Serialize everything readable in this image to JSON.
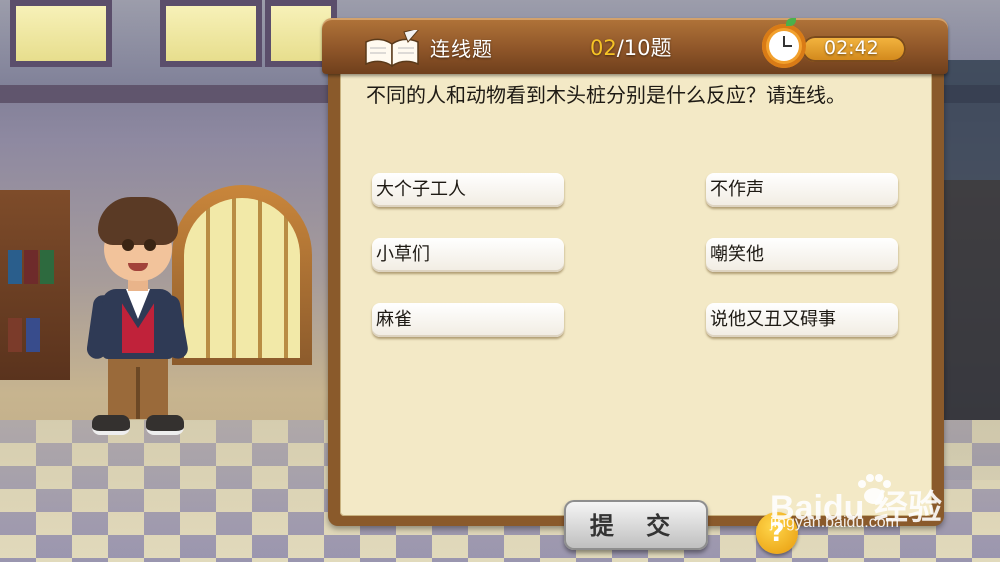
{
  "header": {
    "question_type": "连线题",
    "progress_current": "02",
    "progress_total": "/10题",
    "timer": "02:42"
  },
  "question": {
    "text": "不同的人和动物看到木头桩分别是什么反应？请连线。"
  },
  "left_options": [
    "大个子工人",
    "小草们",
    "麻雀"
  ],
  "right_options": [
    "不作声",
    "嘲笑他",
    "说他又丑又碍事"
  ],
  "buttons": {
    "submit": "提 交",
    "help": "?"
  },
  "watermark": {
    "logo": "Baidu 经验",
    "url": "jingyan.baidu.com"
  }
}
